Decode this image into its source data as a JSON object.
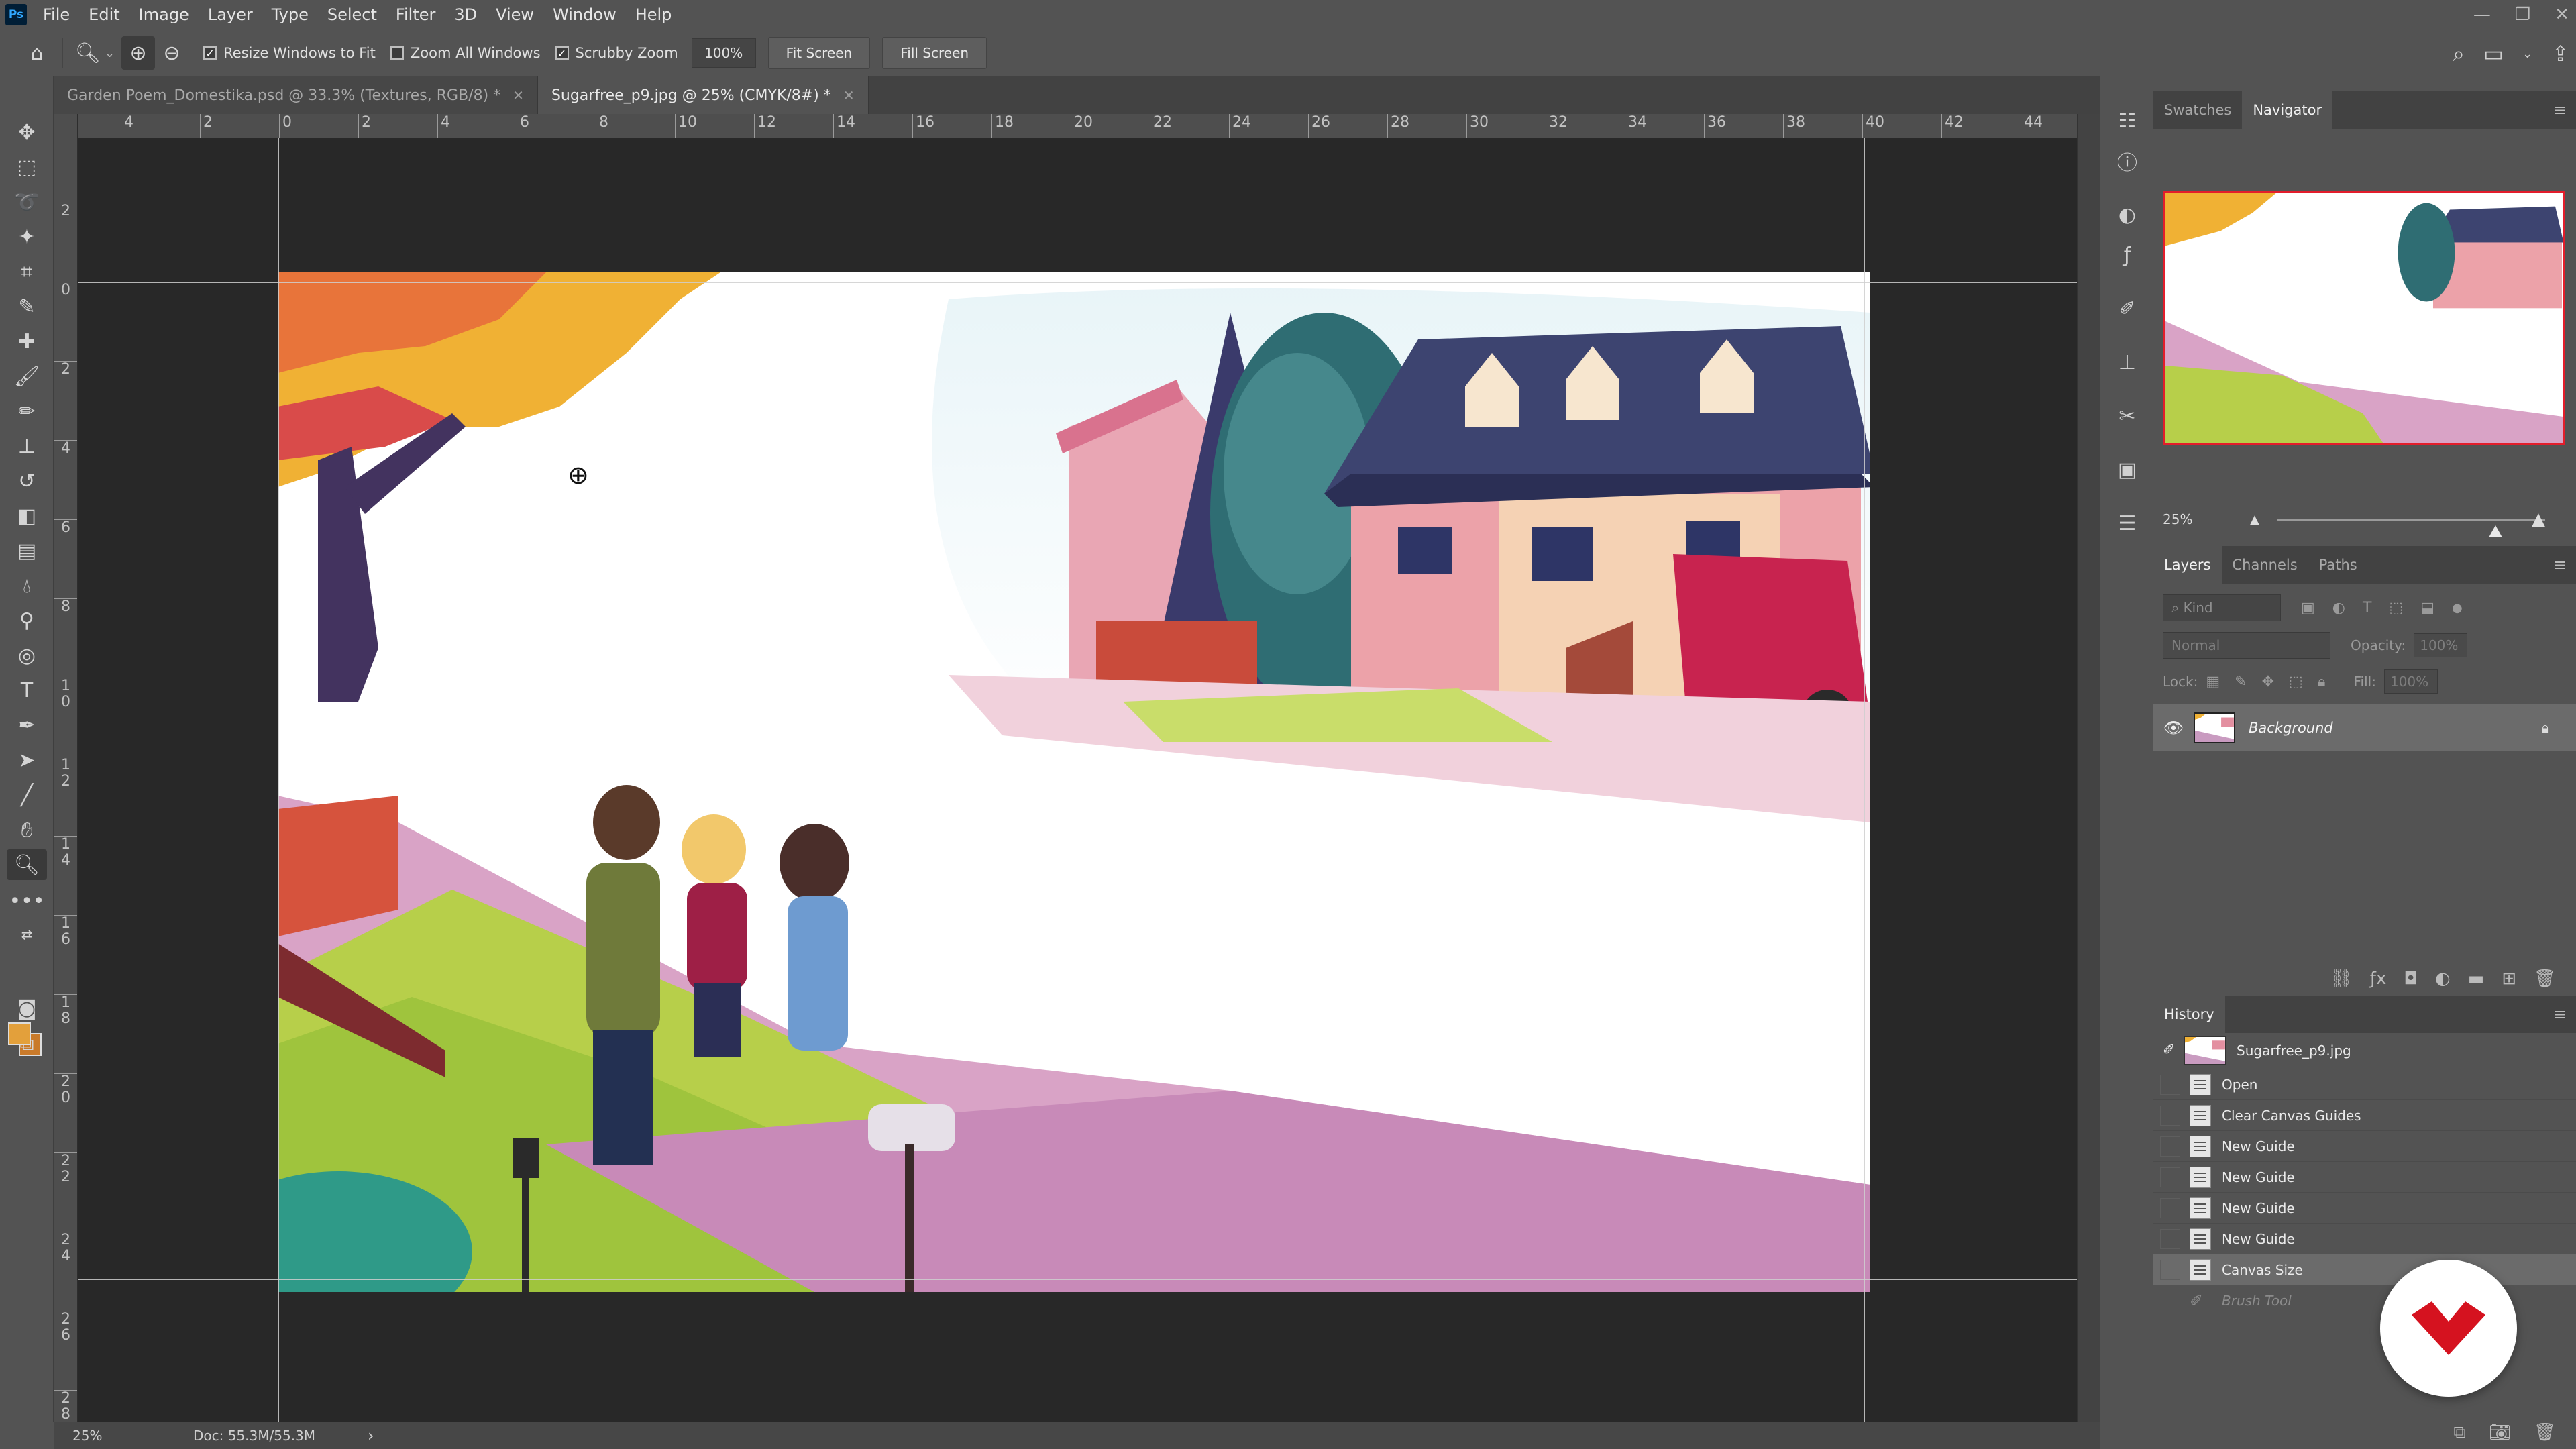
{
  "menu": {
    "items": [
      "File",
      "Edit",
      "Image",
      "Layer",
      "Type",
      "Select",
      "Filter",
      "3D",
      "View",
      "Window",
      "Help"
    ]
  },
  "options": {
    "resize_windows": "Resize Windows to Fit",
    "zoom_all_windows": "Zoom All Windows",
    "scrubby_zoom": "Scrubby Zoom",
    "zoom_value": "100%",
    "fit_screen": "Fit Screen",
    "fill_screen": "Fill Screen"
  },
  "tabs": [
    {
      "title": "Garden Poem_Domestika.psd @ 33.3% (Textures, RGB/8) *"
    },
    {
      "title": "Sugarfree_p9.jpg @ 25% (CMYK/8#) *"
    }
  ],
  "ruler_top": [
    "4",
    "2",
    "0",
    "2",
    "4",
    "6",
    "8",
    "10",
    "12",
    "14",
    "16",
    "18",
    "20",
    "22",
    "24",
    "26",
    "28",
    "30",
    "32",
    "34",
    "36",
    "38",
    "40",
    "42",
    "44"
  ],
  "ruler_left": [
    "2",
    "0",
    "2",
    "4",
    "6",
    "8",
    "1\n0",
    "1\n2",
    "1\n4",
    "1\n6",
    "1\n8",
    "2\n0",
    "2\n2",
    "2\n4",
    "2\n6",
    "2\n8"
  ],
  "status": {
    "zoom": "25%",
    "doc": "Doc: 55.3M/55.3M",
    "arrow": "›"
  },
  "navigator": {
    "tabs": [
      "Swatches",
      "Navigator"
    ],
    "zoom": "25%"
  },
  "layers": {
    "tabs": [
      "Layers",
      "Channels",
      "Paths"
    ],
    "kind_placeholder": "Kind",
    "blend_mode": "Normal",
    "opacity_label": "Opacity:",
    "opacity_value": "100%",
    "lock_label": "Lock:",
    "fill_label": "Fill:",
    "fill_value": "100%",
    "items": [
      {
        "name": "Background"
      }
    ]
  },
  "history": {
    "title": "History",
    "snapshot": "Sugarfree_p9.jpg",
    "steps": [
      "Open",
      "Clear Canvas Guides",
      "New Guide",
      "New Guide",
      "New Guide",
      "New Guide",
      "Canvas Size",
      "Brush Tool"
    ]
  },
  "colors": {
    "foreground": "#e3a03b",
    "background": "#c97a2a",
    "navigator_frame": "#e31d2b",
    "brand": "#d5121f"
  }
}
